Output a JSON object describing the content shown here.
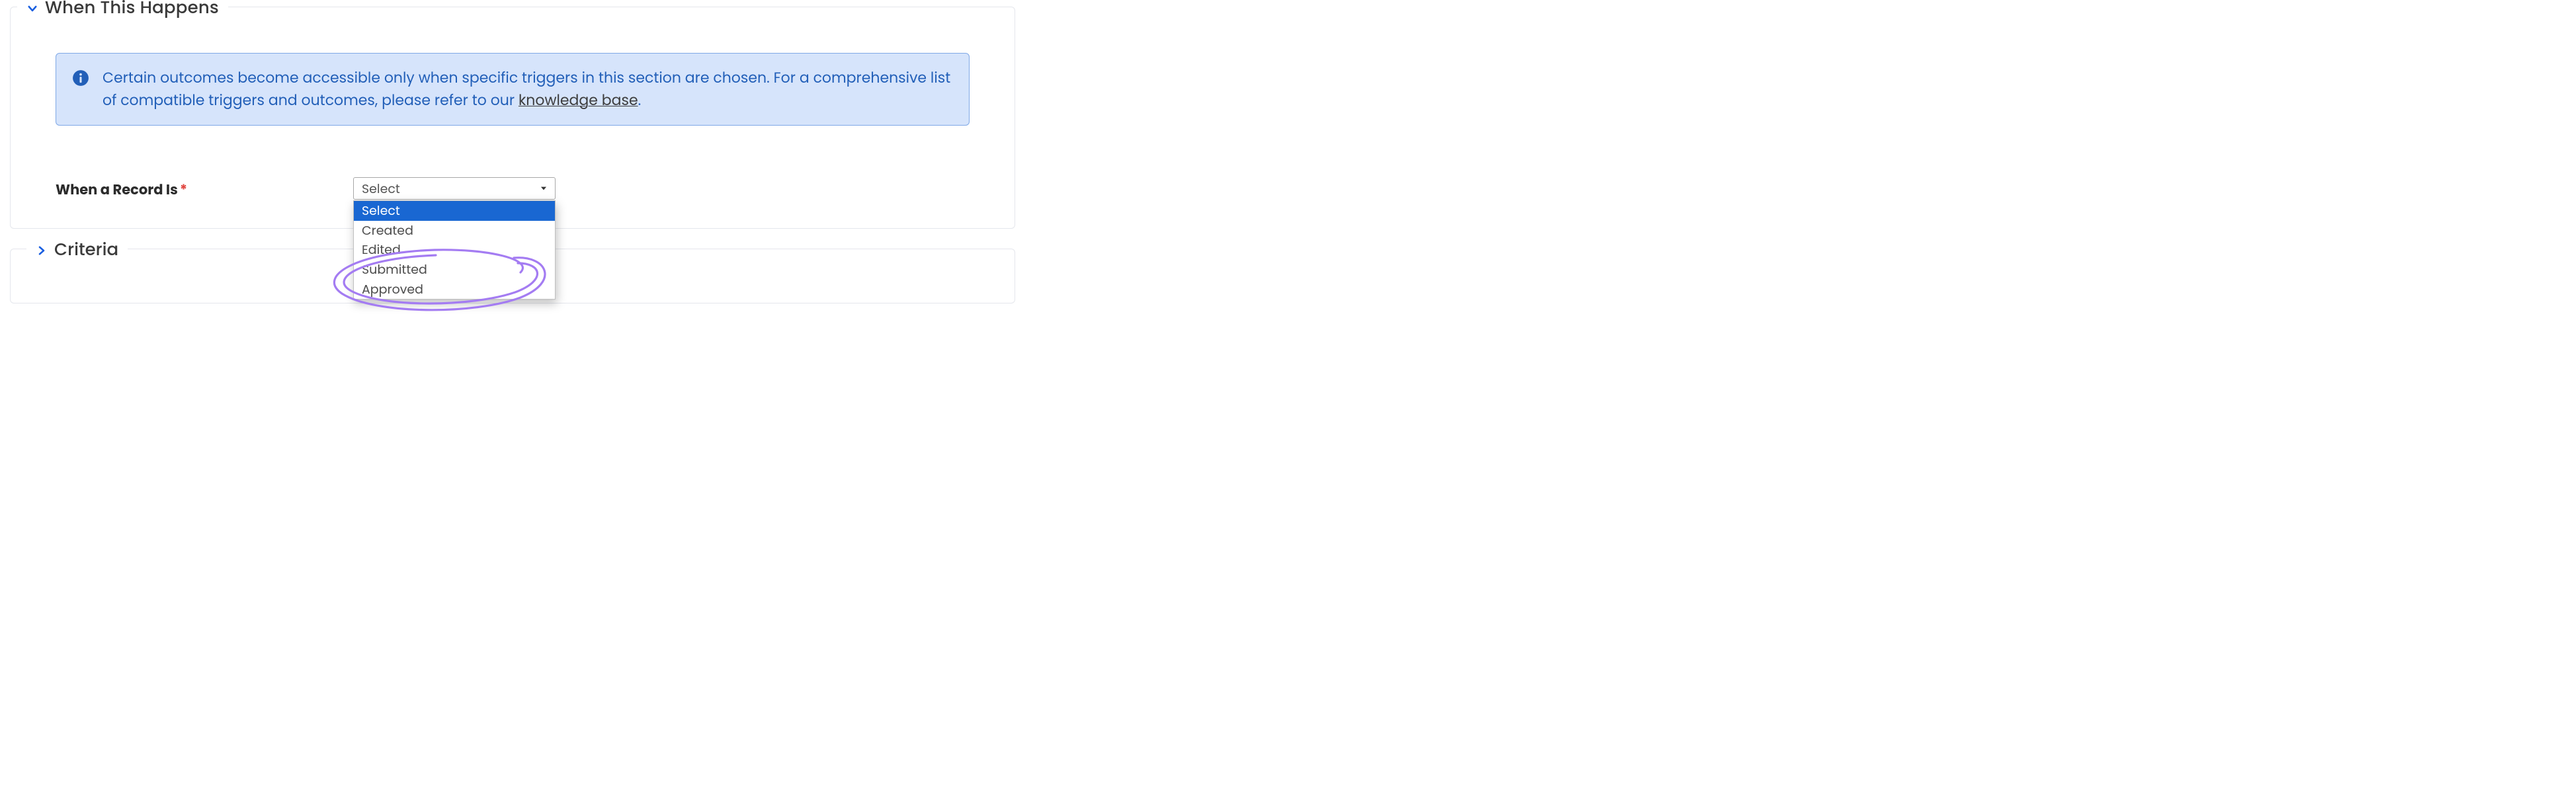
{
  "sections": {
    "when_this_happens": {
      "title": "When This Happens",
      "expanded": true,
      "alert": {
        "text_before_link": "Certain outcomes become accessible only when specific triggers in this section are chosen. For a comprehensive list of compatible triggers and outcomes, please refer to our ",
        "link_text": "knowledge base",
        "text_after_link": "."
      },
      "field": {
        "label": "When a Record Is",
        "required_marker": "*",
        "select": {
          "placeholder": "Select",
          "options": [
            "Select",
            "Created",
            "Edited",
            "Submitted",
            "Approved"
          ],
          "highlighted_index": 0,
          "annotated_index": 3
        }
      }
    },
    "criteria": {
      "title": "Criteria",
      "expanded": false
    }
  },
  "colors": {
    "brand_blue": "#185EE0",
    "alert_bg": "#D6E4FB",
    "alert_border": "#7FA8E6",
    "alert_text": "#225FB8",
    "select_highlight": "#1967D2",
    "required": "#E0443E",
    "scribble": "#A47CF2"
  }
}
